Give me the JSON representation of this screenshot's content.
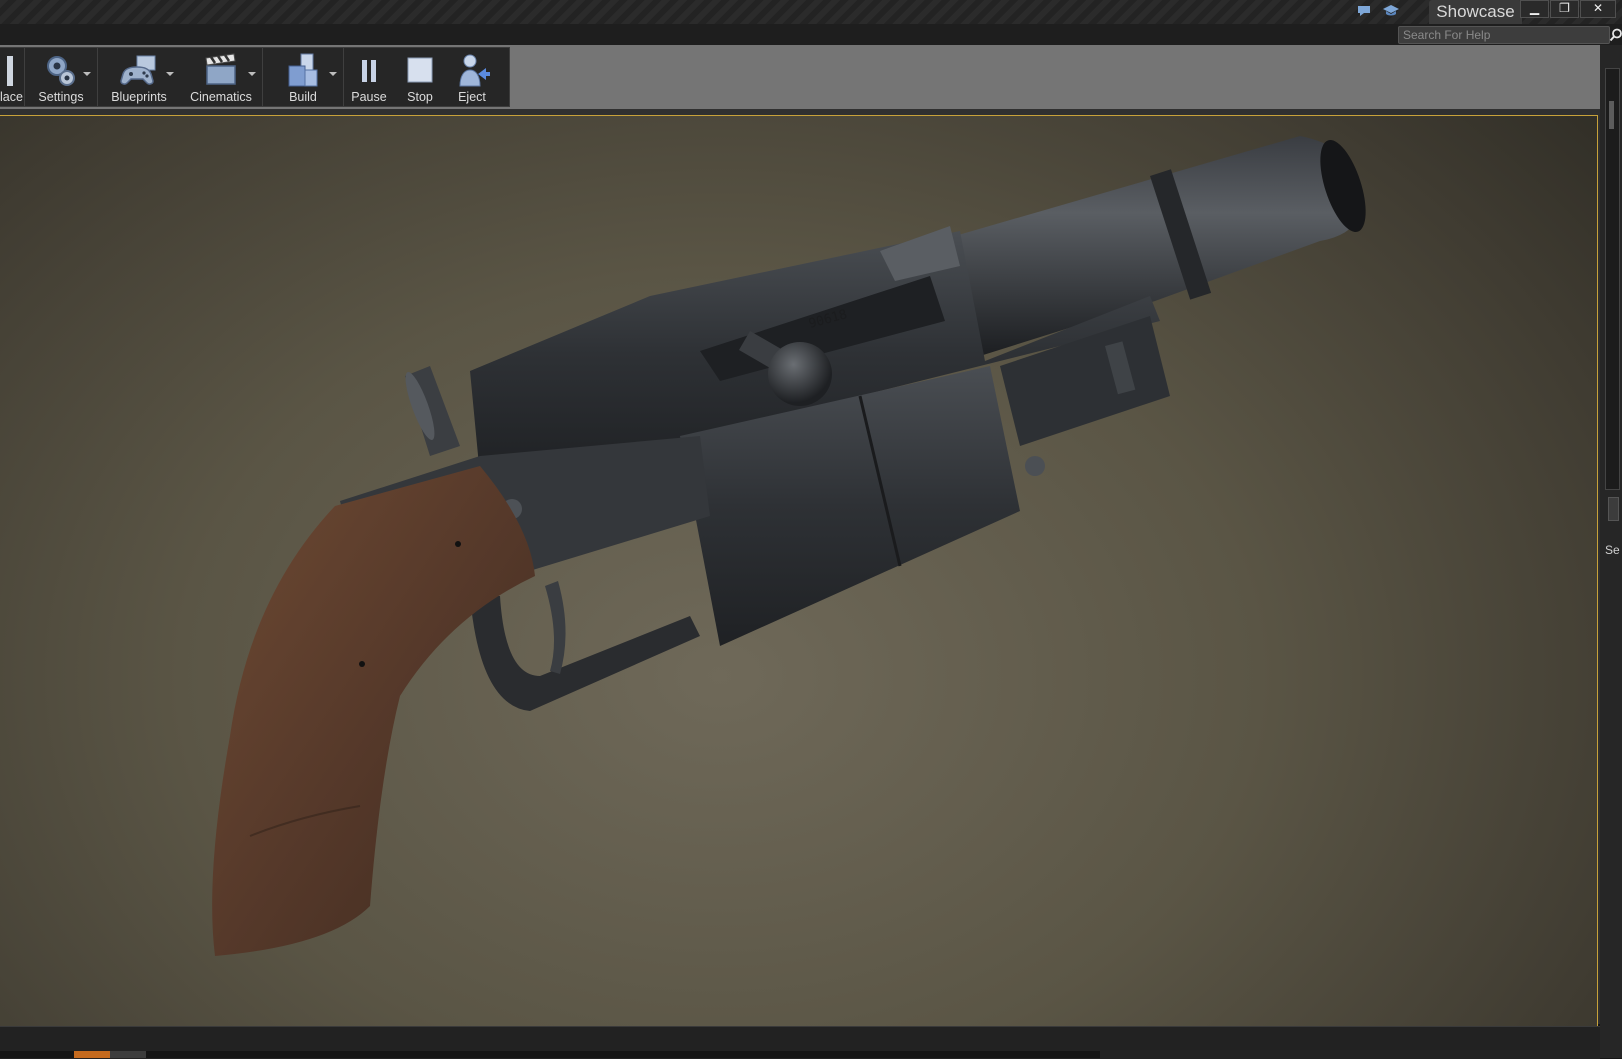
{
  "window": {
    "project_name": "Showcase",
    "controls": {
      "minimize": "▁",
      "restore": "❐",
      "close": "✕"
    },
    "title_icons": [
      "speech-bubble-icon",
      "graduation-cap-icon"
    ]
  },
  "help": {
    "placeholder": "Search For Help",
    "icon": "magnifier-icon"
  },
  "toolbar": {
    "buttons": [
      {
        "label": "lace",
        "icon": "place-icon",
        "has_dropdown": false
      },
      {
        "label": "Settings",
        "icon": "gears-icon",
        "has_dropdown": true
      },
      {
        "label": "Blueprints",
        "icon": "gamepad-icon",
        "has_dropdown": true
      },
      {
        "label": "Cinematics",
        "icon": "clapperboard-icon",
        "has_dropdown": true
      },
      {
        "label": "Build",
        "icon": "build-cubes-icon",
        "has_dropdown": true
      },
      {
        "label": "Pause",
        "icon": "pause-icon",
        "has_dropdown": false
      },
      {
        "label": "Stop",
        "icon": "stop-icon",
        "has_dropdown": false
      },
      {
        "label": "Eject",
        "icon": "eject-person-icon",
        "has_dropdown": false
      }
    ]
  },
  "viewport": {
    "subject": "pistol-3d-model",
    "engraved_serial": "90618"
  },
  "right_panel": {
    "label": "Se"
  },
  "colors": {
    "accent": "#c46a1e",
    "viewport_border": "#c8a23a",
    "toolbar_bg": "#262626",
    "grip_wood": "#5a3a28",
    "gun_metal": "#2c2e31"
  }
}
